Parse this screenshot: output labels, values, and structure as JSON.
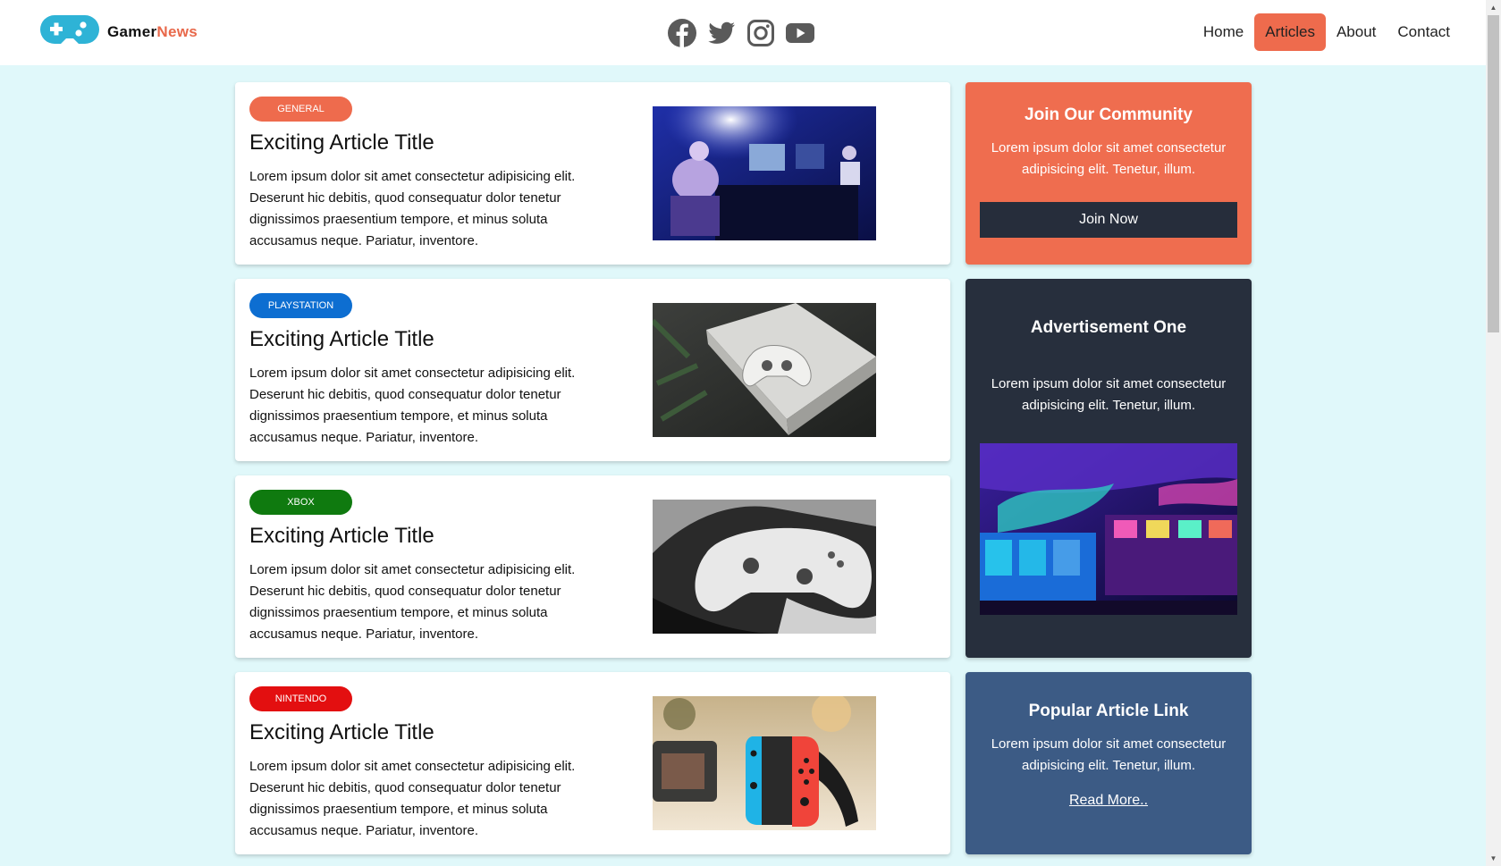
{
  "logo": {
    "part1": "Gamer",
    "part2": "News"
  },
  "social": [
    "facebook-icon",
    "twitter-icon",
    "instagram-icon",
    "youtube-icon"
  ],
  "nav": {
    "home": "Home",
    "articles": "Articles",
    "about": "About",
    "contact": "Contact"
  },
  "articles": [
    {
      "badge": "General",
      "badge_color": "#ee6b4d",
      "title": "Exciting Article Title",
      "text": "Lorem ipsum dolor sit amet consectetur adipisicing elit. Deserunt hic debitis, quod consequatur dolor tenetur dignissimos praesentium tempore, et minus soluta accusamus neque. Pariatur, inventore."
    },
    {
      "badge": "Playstation",
      "badge_color": "#0d6ed1",
      "title": "Exciting Article Title",
      "text": "Lorem ipsum dolor sit amet consectetur adipisicing elit. Deserunt hic debitis, quod consequatur dolor tenetur dignissimos praesentium tempore, et minus soluta accusamus neque. Pariatur, inventore."
    },
    {
      "badge": "Xbox",
      "badge_color": "#0f7a0f",
      "title": "Exciting Article Title",
      "text": "Lorem ipsum dolor sit amet consectetur adipisicing elit. Deserunt hic debitis, quod consequatur dolor tenetur dignissimos praesentium tempore, et minus soluta accusamus neque. Pariatur, inventore."
    },
    {
      "badge": "Nintendo",
      "badge_color": "#e30f10",
      "title": "Exciting Article Title",
      "text": "Lorem ipsum dolor sit amet consectetur adipisicing elit. Deserunt hic debitis, quod consequatur dolor tenetur dignissimos praesentium tempore, et minus soluta accusamus neque. Pariatur, inventore."
    }
  ],
  "sidebar": {
    "community": {
      "title": "Join Our Community",
      "text": "Lorem ipsum dolor sit amet consectetur adipisicing elit. Tenetur, illum.",
      "button": "Join Now"
    },
    "ad": {
      "title": "Advertisement One",
      "text": "Lorem ipsum dolor sit amet consectetur adipisicing elit. Tenetur, illum."
    },
    "popular": {
      "title": "Popular Article Link",
      "text": "Lorem ipsum dolor sit amet consectetur adipisicing elit. Tenetur, illum.",
      "link": "Read More.."
    }
  },
  "colors": {
    "accent": "#ee6b4d",
    "header_bg": "#ffffff",
    "page_bg": "#e0f8fa",
    "dark": "#272f3d",
    "blue": "#3c5b85",
    "logo_blue": "#2eb3d6"
  }
}
